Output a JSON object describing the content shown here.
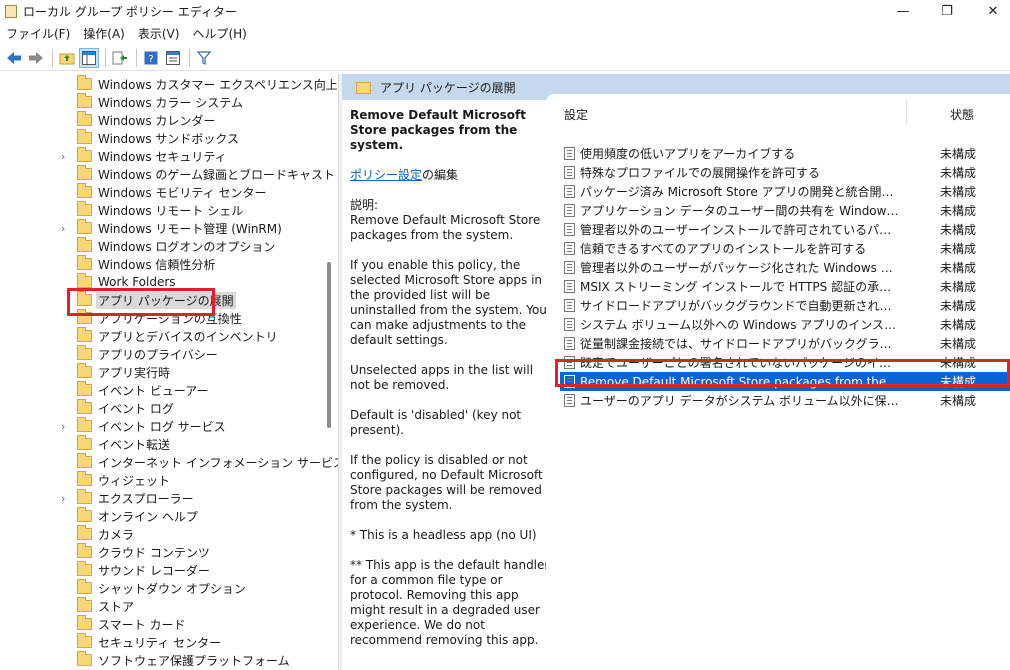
{
  "window": {
    "title": "ローカル グループ ポリシー エディター",
    "minimize": "—",
    "maximize": "❐",
    "close": "✕"
  },
  "menu": [
    "ファイル(F)",
    "操作(A)",
    "表示(V)",
    "ヘルプ(H)"
  ],
  "toolbar": {
    "icons": [
      "back-arrow-icon",
      "forward-arrow-icon",
      "up-folder-icon",
      "show-hide-tree-icon",
      "export-list-icon",
      "help-icon",
      "properties-icon",
      "filter-icon"
    ]
  },
  "tree": {
    "items": [
      {
        "label": "Windows カスタマー エクスペリエンス向上プログ",
        "expandable": false
      },
      {
        "label": "Windows カラー システム",
        "expandable": false
      },
      {
        "label": "Windows カレンダー",
        "expandable": false
      },
      {
        "label": "Windows サンドボックス",
        "expandable": false
      },
      {
        "label": "Windows セキュリティ",
        "expandable": true
      },
      {
        "label": "Windows のゲーム録画とブロードキャスト",
        "expandable": false
      },
      {
        "label": "Windows モビリティ センター",
        "expandable": false
      },
      {
        "label": "Windows リモート シェル",
        "expandable": false
      },
      {
        "label": "Windows リモート管理 (WinRM)",
        "expandable": true
      },
      {
        "label": "Windows ログオンのオプション",
        "expandable": false
      },
      {
        "label": "Windows 信頼性分析",
        "expandable": false
      },
      {
        "label": "Work Folders",
        "expandable": false
      },
      {
        "label": "アプリ パッケージの展開",
        "expandable": false,
        "selected": true
      },
      {
        "label": "アプリケーションの互換性",
        "expandable": false
      },
      {
        "label": "アプリとデバイスのインベントリ",
        "expandable": false
      },
      {
        "label": "アプリのプライバシー",
        "expandable": false
      },
      {
        "label": "アプリ実行時",
        "expandable": false
      },
      {
        "label": "イベント ビューアー",
        "expandable": false
      },
      {
        "label": "イベント ログ",
        "expandable": false
      },
      {
        "label": "イベント ログ サービス",
        "expandable": true
      },
      {
        "label": "イベント転送",
        "expandable": false
      },
      {
        "label": "インターネット インフォメーション サービス",
        "expandable": false
      },
      {
        "label": "ウィジェット",
        "expandable": false
      },
      {
        "label": "エクスプローラー",
        "expandable": true
      },
      {
        "label": "オンライン ヘルプ",
        "expandable": false
      },
      {
        "label": "カメラ",
        "expandable": false
      },
      {
        "label": "クラウド コンテンツ",
        "expandable": false
      },
      {
        "label": "サウンド レコーダー",
        "expandable": false
      },
      {
        "label": "シャットダウン オプション",
        "expandable": false
      },
      {
        "label": "ストア",
        "expandable": false
      },
      {
        "label": "スマート カード",
        "expandable": false
      },
      {
        "label": "セキュリティ センター",
        "expandable": false
      },
      {
        "label": "ソフトウェア保護プラットフォーム",
        "expandable": false
      }
    ]
  },
  "panel": {
    "header": "アプリ パッケージの展開",
    "description": {
      "title": "Remove Default Microsoft Store packages from the system.",
      "edit_link": "ポリシー設定",
      "edit_suffix": "の編集",
      "desc_label": "説明:",
      "desc_text": "Remove Default Microsoft Store packages from the system.",
      "p1": "If you enable this policy, the selected Microsoft Store apps in the provided list will be uninstalled from the system. You can make adjustments to the default settings.",
      "p2": "Unselected apps in the list will not be removed.",
      "p3": "Default is 'disabled' (key not present).",
      "p4": "If the policy is disabled or not configured, no Default Microsoft Store packages will be removed from the system.",
      "p5": "* This is a headless app (no UI)",
      "p6": "** This app is the default handler for a common file type or protocol. Removing this app might result in a degraded user experience. We do not recommend removing this app."
    },
    "columns": {
      "setting": "設定",
      "state": "状態"
    },
    "rows": [
      {
        "name": "使用頻度の低いアプリをアーカイブする",
        "state": "未構成"
      },
      {
        "name": "特殊なプロファイルでの展開操作を許可する",
        "state": "未構成"
      },
      {
        "name": "パッケージ済み Microsoft Store アプリの開発と統合開発環境 (ID...",
        "state": "未構成"
      },
      {
        "name": "アプリケーション データのユーザー間の共有を Windows アプリに許可...",
        "state": "未構成"
      },
      {
        "name": "管理者以外のユーザーインストールで許可されているパッケージ ファミ...",
        "state": "未構成"
      },
      {
        "name": "信頼できるすべてのアプリのインストールを許可する",
        "state": "未構成"
      },
      {
        "name": "管理者以外のユーザーがパッケージ化された Windows アプリをイン...",
        "state": "未構成"
      },
      {
        "name": "MSIX ストリーミング インストールで HTTPS 認証の承認済みドメインを...",
        "state": "未構成"
      },
      {
        "name": "サイドロードアプリがバックグラウンドで自動更新されることを許可しない",
        "state": "未構成"
      },
      {
        "name": "システム ボリューム以外への Windows アプリのインストールを無効に...",
        "state": "未構成"
      },
      {
        "name": "従量制課金接続では、サイドロードアプリがバックグラウンドで自動更...",
        "state": "未構成"
      },
      {
        "name": "既定でユーザーごとの署名されていないパッケージのインストールを許...",
        "state": "未構成"
      },
      {
        "name": "Remove Default Microsoft Store packages from the system.",
        "state": "未構成",
        "selected": true
      },
      {
        "name": "ユーザーのアプリ データがシステム ボリューム以外に保存されないように...",
        "state": "未構成"
      }
    ]
  },
  "colors": {
    "panel_header_bg": "#c5d8ee",
    "selected_row_bg": "#0a64d8",
    "highlight_border": "#e0202a",
    "folder": "#f6d675"
  }
}
